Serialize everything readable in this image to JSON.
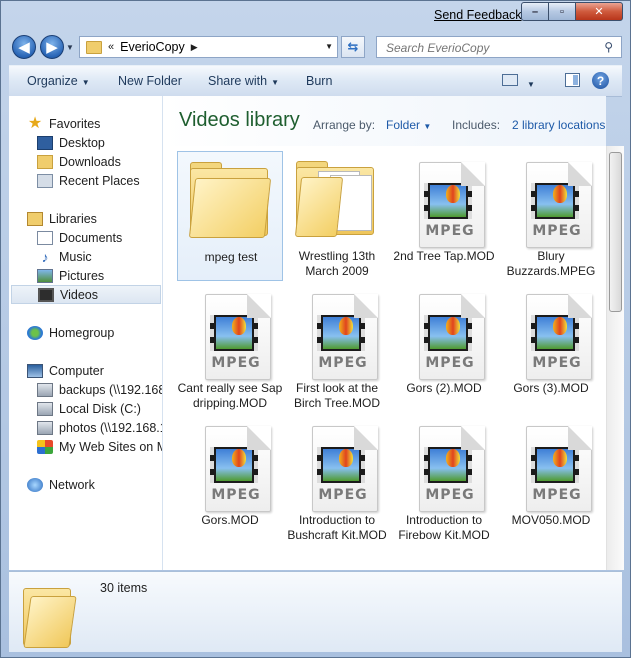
{
  "titlebar": {
    "send_feedback": "Send Feedback",
    "minimize": "–",
    "maximize": "▫",
    "close": "✕"
  },
  "address": {
    "chevron": "«",
    "crumb": "EverioCopy",
    "arrow": "▶"
  },
  "search": {
    "placeholder": "Search EverioCopy"
  },
  "toolbar": {
    "organize": "Organize",
    "new_folder": "New Folder",
    "share_with": "Share with",
    "burn": "Burn"
  },
  "nav": {
    "favorites": {
      "label": "Favorites",
      "items": [
        "Desktop",
        "Downloads",
        "Recent Places"
      ]
    },
    "libraries": {
      "label": "Libraries",
      "items": [
        "Documents",
        "Music",
        "Pictures",
        "Videos"
      ]
    },
    "homegroup": "Homegroup",
    "computer": {
      "label": "Computer",
      "items": [
        "backups (\\\\192.168.",
        "Local Disk (C:)",
        "photos (\\\\192.168.1",
        "My Web Sites on M"
      ]
    },
    "network": "Network"
  },
  "library": {
    "title": "Videos library",
    "arrange_label": "Arrange by:",
    "arrange_value": "Folder",
    "includes_label": "Includes:",
    "includes_value": "2 library locations"
  },
  "files": [
    {
      "label": "mpeg test",
      "kind": "folder"
    },
    {
      "label": "Wrestling 13th March 2009",
      "kind": "folder-docs"
    },
    {
      "label": "2nd Tree Tap.MOD",
      "kind": "mpeg"
    },
    {
      "label": "Blury Buzzards.MPEG",
      "kind": "mpeg"
    },
    {
      "label": "Cant really see Sap dripping.MOD",
      "kind": "mpeg"
    },
    {
      "label": "First look at the Birch Tree.MOD",
      "kind": "mpeg"
    },
    {
      "label": "Gors (2).MOD",
      "kind": "mpeg"
    },
    {
      "label": "Gors (3).MOD",
      "kind": "mpeg"
    },
    {
      "label": "Gors.MOD",
      "kind": "mpeg"
    },
    {
      "label": "Introduction to Bushcraft Kit.MOD",
      "kind": "mpeg"
    },
    {
      "label": "Introduction to Firebow Kit.MOD",
      "kind": "mpeg"
    },
    {
      "label": "MOV050.MOD",
      "kind": "mpeg"
    }
  ],
  "mpeg_text": "MPEG",
  "details": {
    "count": "30 items"
  }
}
